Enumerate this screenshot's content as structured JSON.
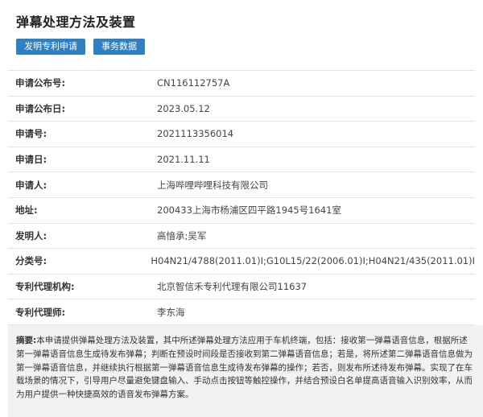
{
  "page": {
    "title": "弹幕处理方法及装置",
    "tags": [
      "发明专利申请",
      "事务数据"
    ]
  },
  "fields": [
    {
      "label": "申请公布号:",
      "value": "CN116112757A"
    },
    {
      "label": "申请公布日:",
      "value": "2023.05.12"
    },
    {
      "label": "申请号:",
      "value": "2021113356014"
    },
    {
      "label": "申请日:",
      "value": "2021.11.11"
    },
    {
      "label": "申请人:",
      "value": "上海哔哩哔哩科技有限公司"
    },
    {
      "label": "地址:",
      "value": "200433上海市杨浦区四平路1945号1641室"
    },
    {
      "label": "发明人:",
      "value": "高愔承;吴军"
    },
    {
      "label": "分类号:",
      "value": "H04N21/4788(2011.01)I;G10L15/22(2006.01)I;H04N21/435(2011.01)I"
    },
    {
      "label": "专利代理机构:",
      "value": "北京智信禾专利代理有限公司11637"
    },
    {
      "label": "专利代理师:",
      "value": "李东海"
    }
  ],
  "abstract": {
    "label": "摘要:",
    "text": "本申请提供弹幕处理方法及装置，其中所述弹幕处理方法应用于车机终端，包括：接收第一弹幕语音信息，根据所述第一弹幕语音信息生成待发布弹幕；判断在预设时间段是否接收到第二弹幕语音信息；若是，将所述第二弹幕语音信息做为第一弹幕语音信息，并继续执行根据第一弹幕语音信息生成待发布弹幕的操作；若否，则发布所述待发布弹幕。实现了在车载场景的情况下，引导用户尽量避免键盘输入、手动点击按钮等触控操作，并结合预设白名单提高语音输入识别效率，从而为用户提供一种快捷高效的语音发布弹幕方案。"
  }
}
